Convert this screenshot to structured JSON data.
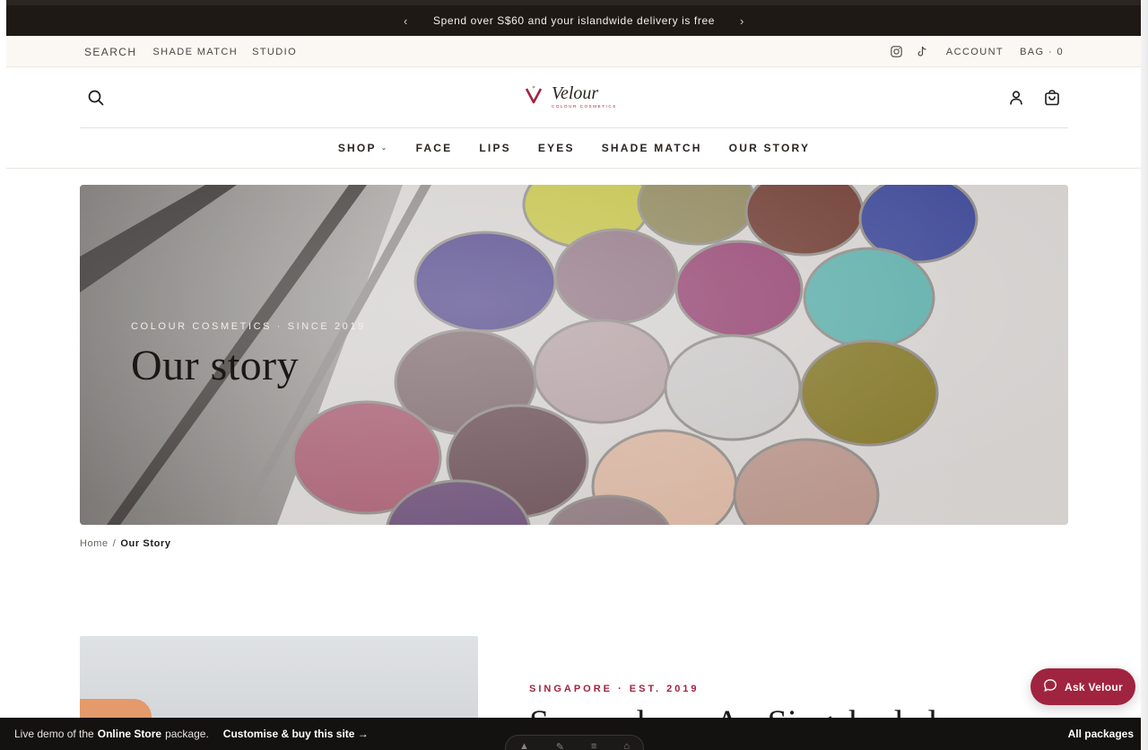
{
  "announcement": {
    "prev": "‹",
    "text": "Spend over S$60 and your islandwide delivery is free",
    "next": "›"
  },
  "utility": {
    "left": [
      "SEARCH",
      "SHADE MATCH",
      "STUDIO"
    ],
    "account": "ACCOUNT",
    "bag": "BAG · 0",
    "icons": [
      "instagram-icon",
      "tiktok-icon"
    ]
  },
  "header": {
    "logo_name": "Velour",
    "logo_sub": "COLOUR COSMETICS",
    "icons": [
      "search-icon",
      "account-icon",
      "bag-icon"
    ]
  },
  "nav": {
    "items": [
      {
        "label": "SHOP",
        "dropdown": true
      },
      {
        "label": "FACE"
      },
      {
        "label": "LIPS"
      },
      {
        "label": "EYES"
      },
      {
        "label": "SHADE MATCH"
      },
      {
        "label": "OUR STORY"
      }
    ]
  },
  "hero": {
    "eyebrow": "COLOUR COSMETICS · SINCE 2019",
    "title": "Our story"
  },
  "breadcrumb": {
    "home": "Home",
    "sep": "/",
    "current": "Our Story"
  },
  "story": {
    "eyebrow": "SINGAPORE · EST. 2019",
    "heading": "Somewhere, An Singaboded"
  },
  "ask_button": {
    "label": "Ask Velour"
  },
  "demo_bar": {
    "prefix": "Live demo of the",
    "package": "Online Store",
    "suffix": "package.",
    "cta": "Customise & buy this site →",
    "right": "All packages"
  },
  "colors": {
    "accent": "#a0243f",
    "announce_bg": "#1e1915",
    "demo_bg": "#141211"
  }
}
